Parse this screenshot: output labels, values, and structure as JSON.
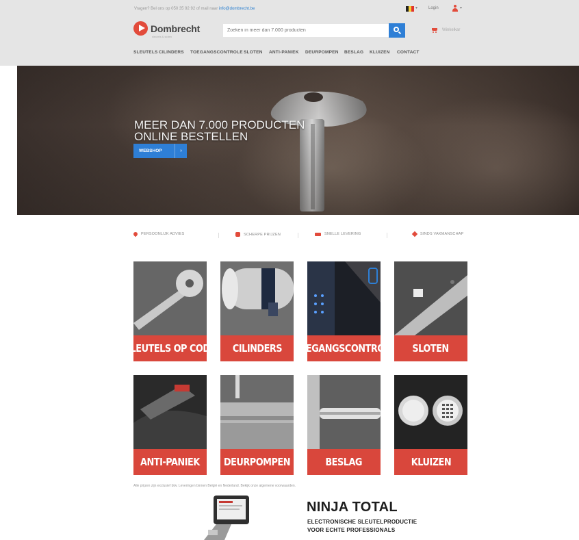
{
  "topbar": {
    "contact_text": "Vragen? Bel ons op 050 35 92 92 of mail naar",
    "contact_link": "info@dombrecht.be",
    "login": "Login"
  },
  "header": {
    "logo_text": "Dombrecht",
    "logo_sub": "sleutels & sloten",
    "search_placeholder": "Zoeken in meer dan 7.000 producten",
    "cart_label": "Winkelkar"
  },
  "nav": {
    "items": [
      "SLEUTELS",
      "CILINDERS",
      "TOEGANGSCONTROLE",
      "SLOTEN",
      "ANTI-PANIEK",
      "DEURPOMPEN",
      "BESLAG",
      "KLUIZEN",
      "CONTACT"
    ]
  },
  "hero": {
    "title_line1": "MEER DAN 7.000 PRODUCTEN",
    "title_line2": "ONLINE BESTELLEN",
    "button_label": "WEBSHOP"
  },
  "usps": [
    "PERSOONLIJK ADVIES",
    "SCHERPE PRIJZEN",
    "SNELLE LEVERING",
    "SINDS VAKMANSCHAP"
  ],
  "categories": [
    {
      "label": "SLEUTELS OP CODE"
    },
    {
      "label": "CILINDERS"
    },
    {
      "label": "TOEGANGSCONTROLE"
    },
    {
      "label": "SLOTEN"
    },
    {
      "label": "ANTI-PANIEK"
    },
    {
      "label": "DEURPOMPEN"
    },
    {
      "label": "BESLAG"
    },
    {
      "label": "KLUIZEN"
    }
  ],
  "notice": "Alle prijzen zijn exclusief btw. Leveringen binnen België en Nederland. Bekijk onze algemene voorwaarden.",
  "promo": {
    "title": "NINJA TOTAL",
    "subtitle_line1": "ELECTRONISCHE SLEUTELPRODUCTIE",
    "subtitle_line2": "VOOR ECHTE PROFESSIONALS"
  },
  "colors": {
    "accent_red": "#d9473c",
    "brand_blue": "#2e7fd6",
    "header_bg": "#e5e5e5"
  },
  "icons": [
    "pin-icon",
    "tag-icon",
    "truck-icon",
    "heart-icon",
    "cart-icon",
    "user-icon",
    "search-icon"
  ]
}
